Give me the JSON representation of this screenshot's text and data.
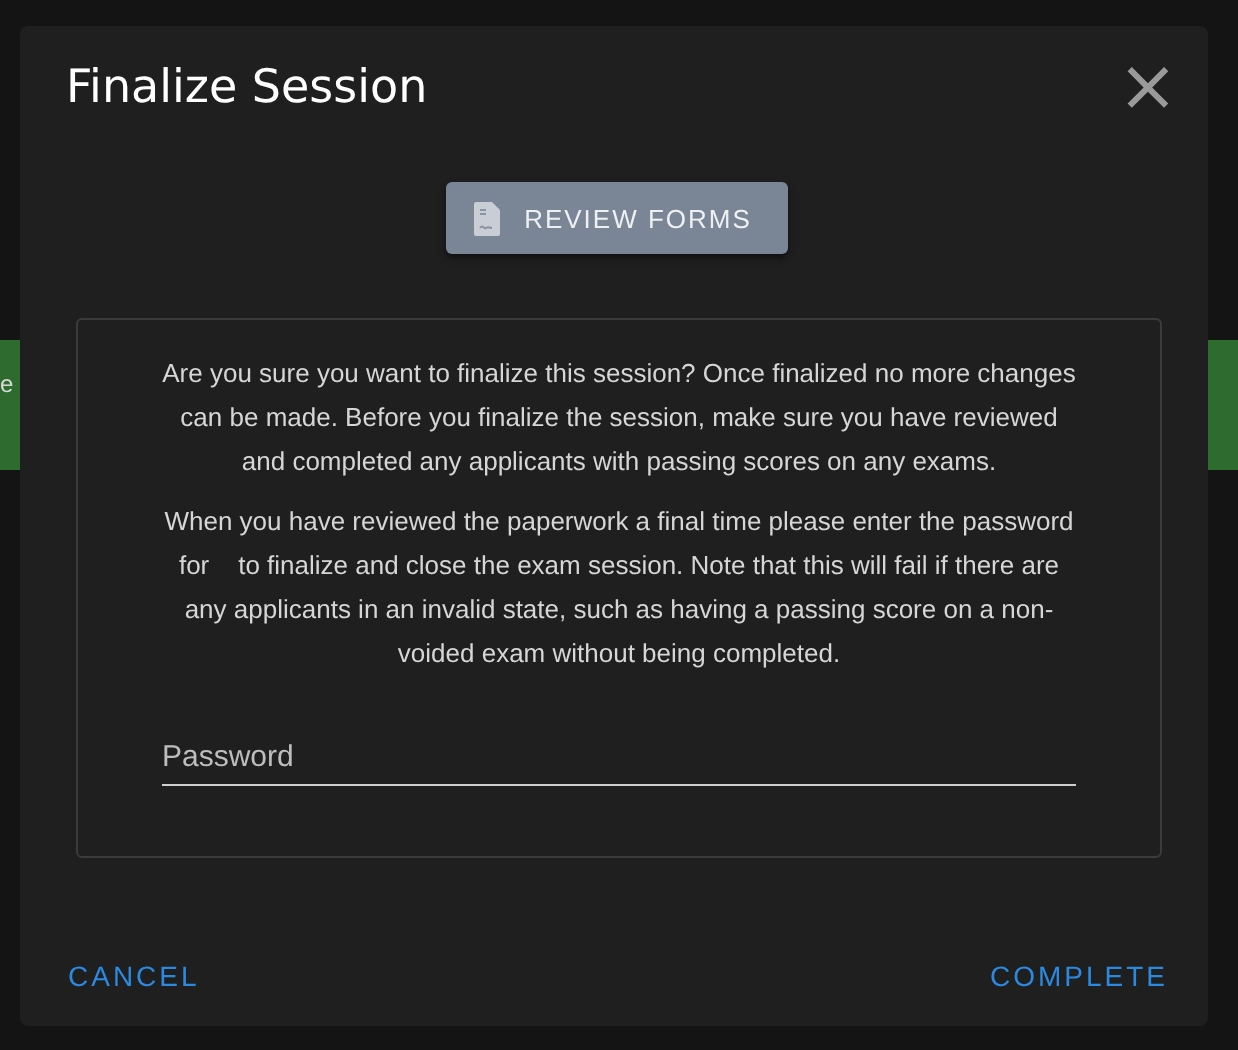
{
  "backdrop": {
    "text_fragment": "e"
  },
  "dialog": {
    "title": "Finalize Session",
    "close": "×",
    "review_button": {
      "label": "REVIEW FORMS"
    },
    "paragraphs": [
      "Are you sure you want to finalize this session? Once finalized no more changes can be made. Before you finalize the session, make sure you have reviewed and completed any applicants with passing scores on any exams.",
      "When you have reviewed the paperwork a final time please enter the password for    to finalize and close the exam session. Note that this will fail if there are any applicants in an invalid state, such as having a passing score on a non-voided exam without being completed."
    ],
    "password": {
      "placeholder": "Password"
    },
    "actions": [
      {
        "label": "CANCEL"
      },
      {
        "label": "COMPLETE"
      }
    ]
  }
}
